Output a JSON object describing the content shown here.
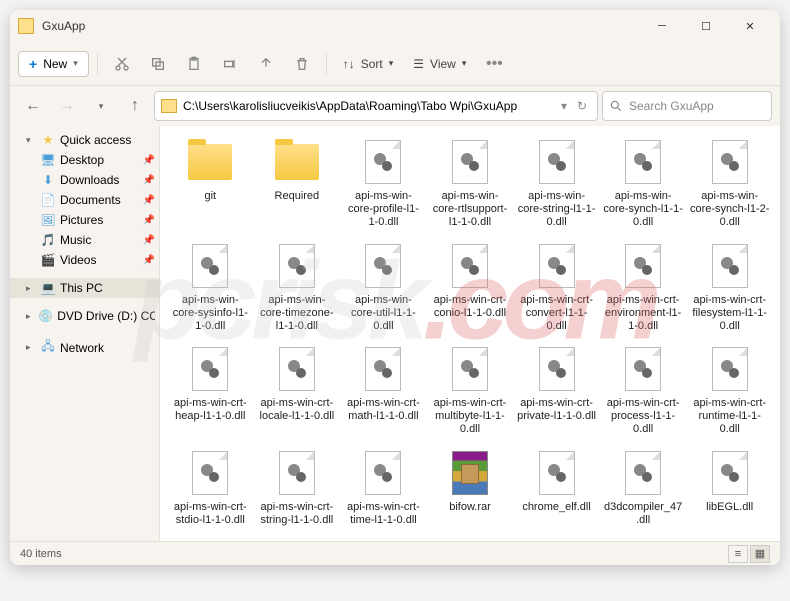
{
  "window": {
    "title": "GxuApp"
  },
  "toolbar": {
    "new": "New",
    "sort": "Sort",
    "view": "View"
  },
  "address": {
    "path": "C:\\Users\\karolisliucveikis\\AppData\\Roaming\\Tabo Wpi\\GxuApp"
  },
  "search": {
    "placeholder": "Search GxuApp"
  },
  "nav": {
    "quick": "Quick access",
    "desktop": "Desktop",
    "downloads": "Downloads",
    "documents": "Documents",
    "pictures": "Pictures",
    "music": "Music",
    "videos": "Videos",
    "thispc": "This PC",
    "dvd": "DVD Drive (D:) CCCC",
    "network": "Network"
  },
  "files": [
    {
      "name": "git",
      "type": "folder"
    },
    {
      "name": "Required",
      "type": "folder"
    },
    {
      "name": "api-ms-win-core-profile-l1-1-0.dll",
      "type": "dll"
    },
    {
      "name": "api-ms-win-core-rtlsupport-l1-1-0.dll",
      "type": "dll"
    },
    {
      "name": "api-ms-win-core-string-l1-1-0.dll",
      "type": "dll"
    },
    {
      "name": "api-ms-win-core-synch-l1-1-0.dll",
      "type": "dll"
    },
    {
      "name": "api-ms-win-core-synch-l1-2-0.dll",
      "type": "dll"
    },
    {
      "name": "api-ms-win-core-sysinfo-l1-1-0.dll",
      "type": "dll"
    },
    {
      "name": "api-ms-win-core-timezone-l1-1-0.dll",
      "type": "dll"
    },
    {
      "name": "api-ms-win-core-util-l1-1-0.dll",
      "type": "dll"
    },
    {
      "name": "api-ms-win-crt-conio-l1-1-0.dll",
      "type": "dll"
    },
    {
      "name": "api-ms-win-crt-convert-l1-1-0.dll",
      "type": "dll"
    },
    {
      "name": "api-ms-win-crt-environment-l1-1-0.dll",
      "type": "dll"
    },
    {
      "name": "api-ms-win-crt-filesystem-l1-1-0.dll",
      "type": "dll"
    },
    {
      "name": "api-ms-win-crt-heap-l1-1-0.dll",
      "type": "dll"
    },
    {
      "name": "api-ms-win-crt-locale-l1-1-0.dll",
      "type": "dll"
    },
    {
      "name": "api-ms-win-crt-math-l1-1-0.dll",
      "type": "dll"
    },
    {
      "name": "api-ms-win-crt-multibyte-l1-1-0.dll",
      "type": "dll"
    },
    {
      "name": "api-ms-win-crt-private-l1-1-0.dll",
      "type": "dll"
    },
    {
      "name": "api-ms-win-crt-process-l1-1-0.dll",
      "type": "dll"
    },
    {
      "name": "api-ms-win-crt-runtime-l1-1-0.dll",
      "type": "dll"
    },
    {
      "name": "api-ms-win-crt-stdio-l1-1-0.dll",
      "type": "dll"
    },
    {
      "name": "api-ms-win-crt-string-l1-1-0.dll",
      "type": "dll"
    },
    {
      "name": "api-ms-win-crt-time-l1-1-0.dll",
      "type": "dll"
    },
    {
      "name": "bifow.rar",
      "type": "rar"
    },
    {
      "name": "chrome_elf.dll",
      "type": "dll"
    },
    {
      "name": "d3dcompiler_47.dll",
      "type": "dll"
    },
    {
      "name": "libEGL.dll",
      "type": "dll"
    }
  ],
  "status": {
    "count": "40 items"
  },
  "watermark": {
    "p1": "pcrisk",
    "p2": ".com"
  }
}
